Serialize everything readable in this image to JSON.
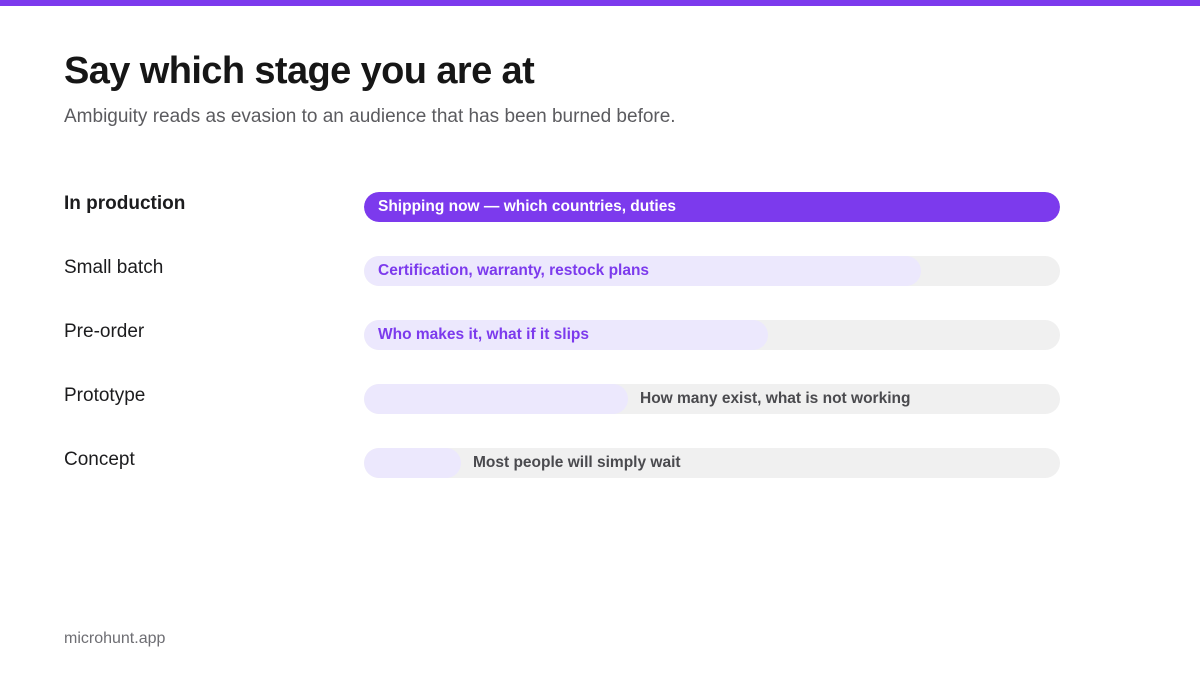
{
  "accent_color": "#7c3aed",
  "fill_color": "#ece8fd",
  "track_color": "#f0f0f0",
  "title": "Say which stage you are at",
  "subtitle": "Ambiguity reads as evasion to an audience that has been burned before.",
  "stages": [
    {
      "label": "In production",
      "note": "Shipping now — which countries, duties",
      "level": 1.0,
      "active": true,
      "note_position": "inside"
    },
    {
      "label": "Small batch",
      "note": "Certification, warranty, restock plans",
      "level": 0.8,
      "active": false,
      "note_position": "inside"
    },
    {
      "label": "Pre-order",
      "note": "Who makes it, what if it slips",
      "level": 0.58,
      "active": false,
      "note_position": "inside"
    },
    {
      "label": "Prototype",
      "note": "How many exist, what is not working",
      "level": 0.38,
      "active": false,
      "note_position": "outside"
    },
    {
      "label": "Concept",
      "note": "Most people will simply wait",
      "level": 0.14,
      "active": false,
      "note_position": "outside"
    }
  ],
  "footer": "microhunt.app"
}
